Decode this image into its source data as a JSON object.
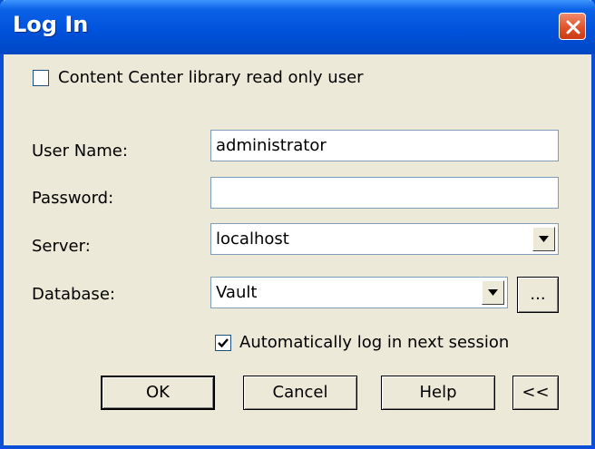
{
  "window": {
    "title": "Log In"
  },
  "options": {
    "content_center_label": "Content Center library read only user",
    "content_center_checked": false
  },
  "form": {
    "username_label": "User Name:",
    "username_value": "administrator",
    "password_label": "Password:",
    "password_value": "",
    "server_label": "Server:",
    "server_value": "localhost",
    "database_label": "Database:",
    "database_value": "Vault",
    "browse_label": "...",
    "auto_login_label": "Automatically log in next session",
    "auto_login_checked": true
  },
  "buttons": {
    "ok": "OK",
    "cancel": "Cancel",
    "help": "Help",
    "collapse": "<<"
  }
}
